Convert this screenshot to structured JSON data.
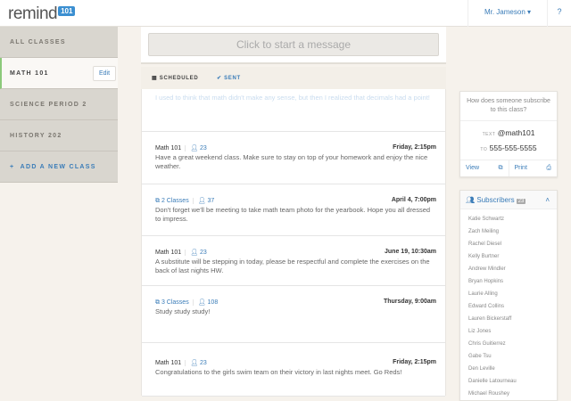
{
  "header": {
    "logo_text": "remind",
    "logo_badge": "101",
    "user": "Mr. Jameson",
    "help": "?"
  },
  "sidebar": {
    "items": [
      {
        "label": "ALL CLASSES"
      },
      {
        "label": "MATH 101",
        "edit": "Edit"
      },
      {
        "label": "SCIENCE PERIOD 2"
      },
      {
        "label": "HISTORY 202"
      },
      {
        "label": "ADD A NEW CLASS"
      }
    ]
  },
  "composer": {
    "placeholder": "Click to start a message"
  },
  "tabs": {
    "scheduled": "SCHEDULED",
    "sent": "SENT"
  },
  "messages": [
    {
      "text": "I used to think that math didn't make any sense, but then I realized that decimals had a point!"
    },
    {
      "cls": "Math 101",
      "count": "23",
      "date": "Friday, 2:15pm",
      "text": "Have a great weekend class.  Make sure to stay on top of your homework and enjoy the nice weather."
    },
    {
      "cls": "2 Classes",
      "count": "37",
      "date": "April 4, 7:00pm",
      "text": "Don't forget we'll be meeting to take math team photo for the yearbook.  Hope you all dressed to impress."
    },
    {
      "cls": "Math 101",
      "count": "23",
      "date": "June 19, 10:30am",
      "text": "A substitute will be stepping in today, please be respectful and complete the exercises on the back of last nights HW."
    },
    {
      "cls": "3 Classes",
      "count": "108",
      "date": "Thursday, 9:00am",
      "text": "Study study study!"
    },
    {
      "cls": "Math 101",
      "count": "23",
      "date": "Friday, 2:15pm",
      "text": "Congratulations to the girls swim team on their victory in last nights meet.  Go Reds!"
    }
  ],
  "subscribe": {
    "question": "How does someone subscribe to this class?",
    "text_label": "TEXT",
    "code": "@math101",
    "to_label": "TO",
    "number": "555-555-5555",
    "view": "View",
    "print": "Print"
  },
  "subscribers": {
    "title": "Subscribers",
    "count": "23",
    "names": [
      "Katie Schwartz",
      "Zach Meiling",
      "Rachel Diesel",
      "Kelly Burtner",
      "Andrew Mindler",
      "Bryan Hopkins",
      "Laurie Alling",
      "Edward Collins",
      "Lauren Bickerstaff",
      "Liz Jones",
      "Chris Guitierrez",
      "Gabe Tsu",
      "Den Leville",
      "Danielle Latourneau",
      "Michael Roushey"
    ]
  }
}
